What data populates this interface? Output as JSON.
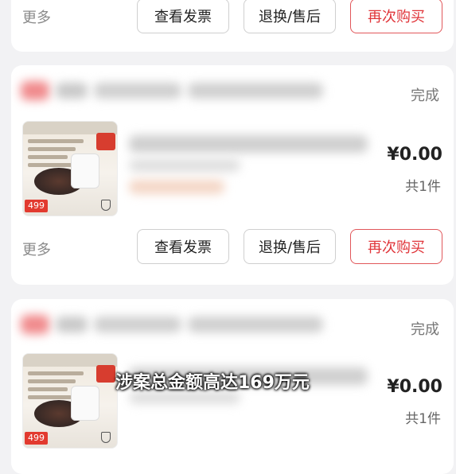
{
  "orders": [
    {
      "more": "更多",
      "buttons": {
        "invoice": "查看发票",
        "return": "退换/售后",
        "rebuy": "再次购买"
      }
    },
    {
      "status": "完成",
      "amount": "¥0.00",
      "quantity": "共1件",
      "thumb_price": "499",
      "more": "更多",
      "buttons": {
        "invoice": "查看发票",
        "return": "退换/售后",
        "rebuy": "再次购买"
      }
    },
    {
      "status": "完成",
      "amount": "¥0.00",
      "quantity": "共1件",
      "thumb_price": "499"
    }
  ],
  "overlay_caption": "涉案总金额高达169万元",
  "colors": {
    "accent": "#e0353a",
    "background": "#f2f2f4"
  }
}
